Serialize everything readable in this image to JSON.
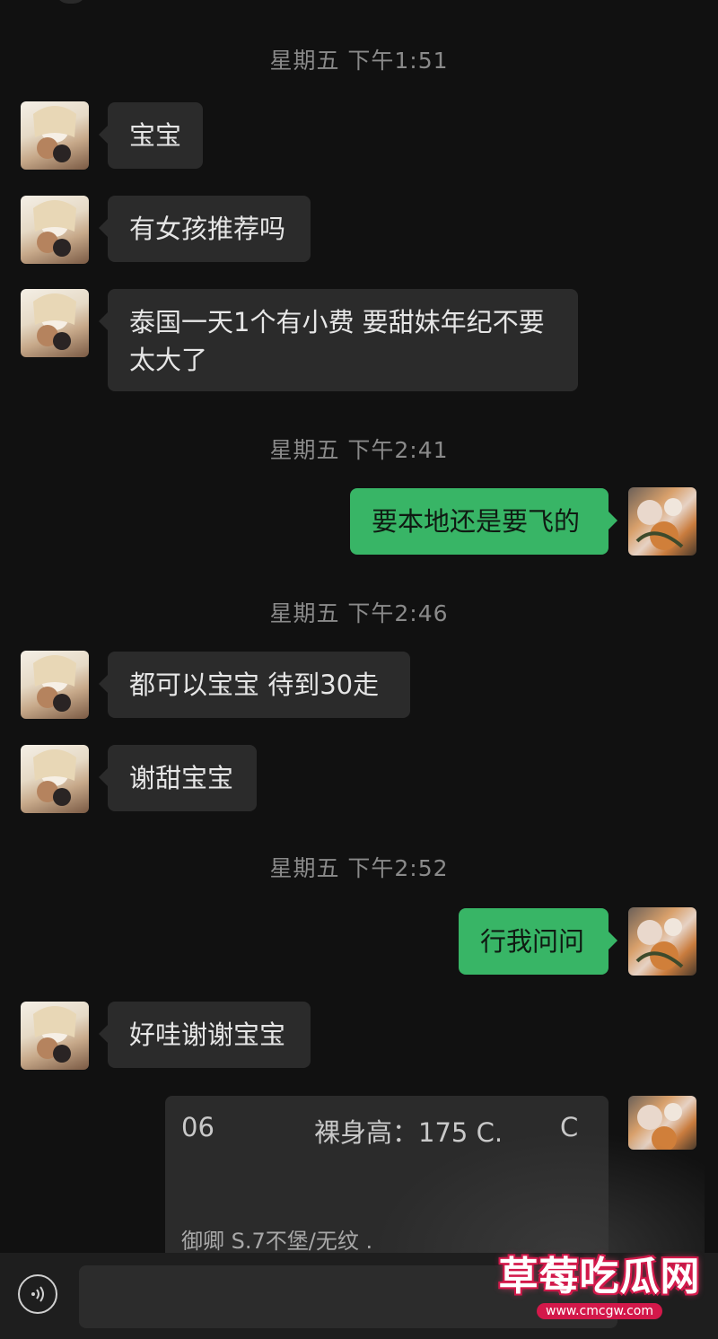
{
  "chat": {
    "timestamps": [
      "星期五 下午1:51",
      "星期五 下午2:41",
      "星期五 下午2:46",
      "星期五 下午2:52"
    ],
    "messages": [
      {
        "side": "left",
        "text": "宝宝"
      },
      {
        "side": "left",
        "text": "有女孩推荐吗"
      },
      {
        "side": "left",
        "text": "泰国一天1个有小费 要甜妹年纪不要太大了"
      },
      {
        "side": "right",
        "text": "要本地还是要飞的"
      },
      {
        "side": "left",
        "text": "都可以宝宝 待到30走"
      },
      {
        "side": "left",
        "text": "谢甜宝宝"
      },
      {
        "side": "right",
        "text": "行我问问"
      },
      {
        "side": "left",
        "text": "好哇谢谢宝宝"
      }
    ],
    "card": {
      "number": "06",
      "spec": "裸身高：175 C.",
      "spec_extra": "C",
      "note": "御卿 S.7不堡/无纹 ."
    }
  },
  "watermark": {
    "title": "草莓吃瓜网",
    "url": "www.cmcgw.com"
  },
  "colors": {
    "background": "#111111",
    "incoming_bubble": "#2b2b2b",
    "outgoing_bubble": "#38b566",
    "timestamp_text": "#8a8a8a"
  },
  "icons": {
    "voice": "voice-input-icon",
    "avatar_other": "anime-girl-avatar",
    "avatar_self": "flower-avatar"
  }
}
